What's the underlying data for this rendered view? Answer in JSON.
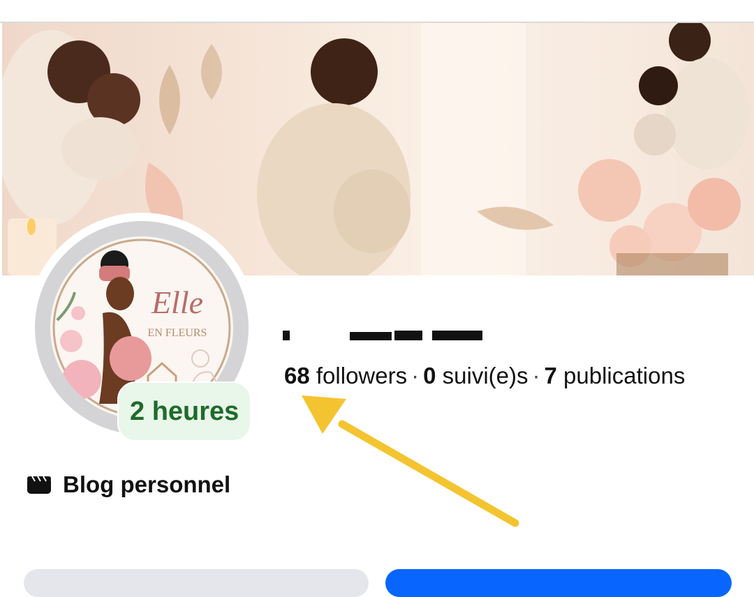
{
  "profile": {
    "page_name": "Elle en Fleurs",
    "status_badge": "2 heures",
    "stats": {
      "followers_count": "68",
      "followers_label": "followers",
      "following_count": "0",
      "following_label": "suivi(e)s",
      "posts_count": "7",
      "posts_label": "publications",
      "separator": "·"
    },
    "category": "Blog personnel",
    "category_icon": "clapperboard-icon"
  },
  "logo": {
    "title": "Elle",
    "subtitle": "EN FLEURS"
  },
  "colors": {
    "badge_bg": "#e9f6ea",
    "badge_text": "#1f6b2a",
    "arrow": "#f4c430",
    "primary_button": "#0866ff",
    "secondary_button": "#e5e6eb"
  }
}
